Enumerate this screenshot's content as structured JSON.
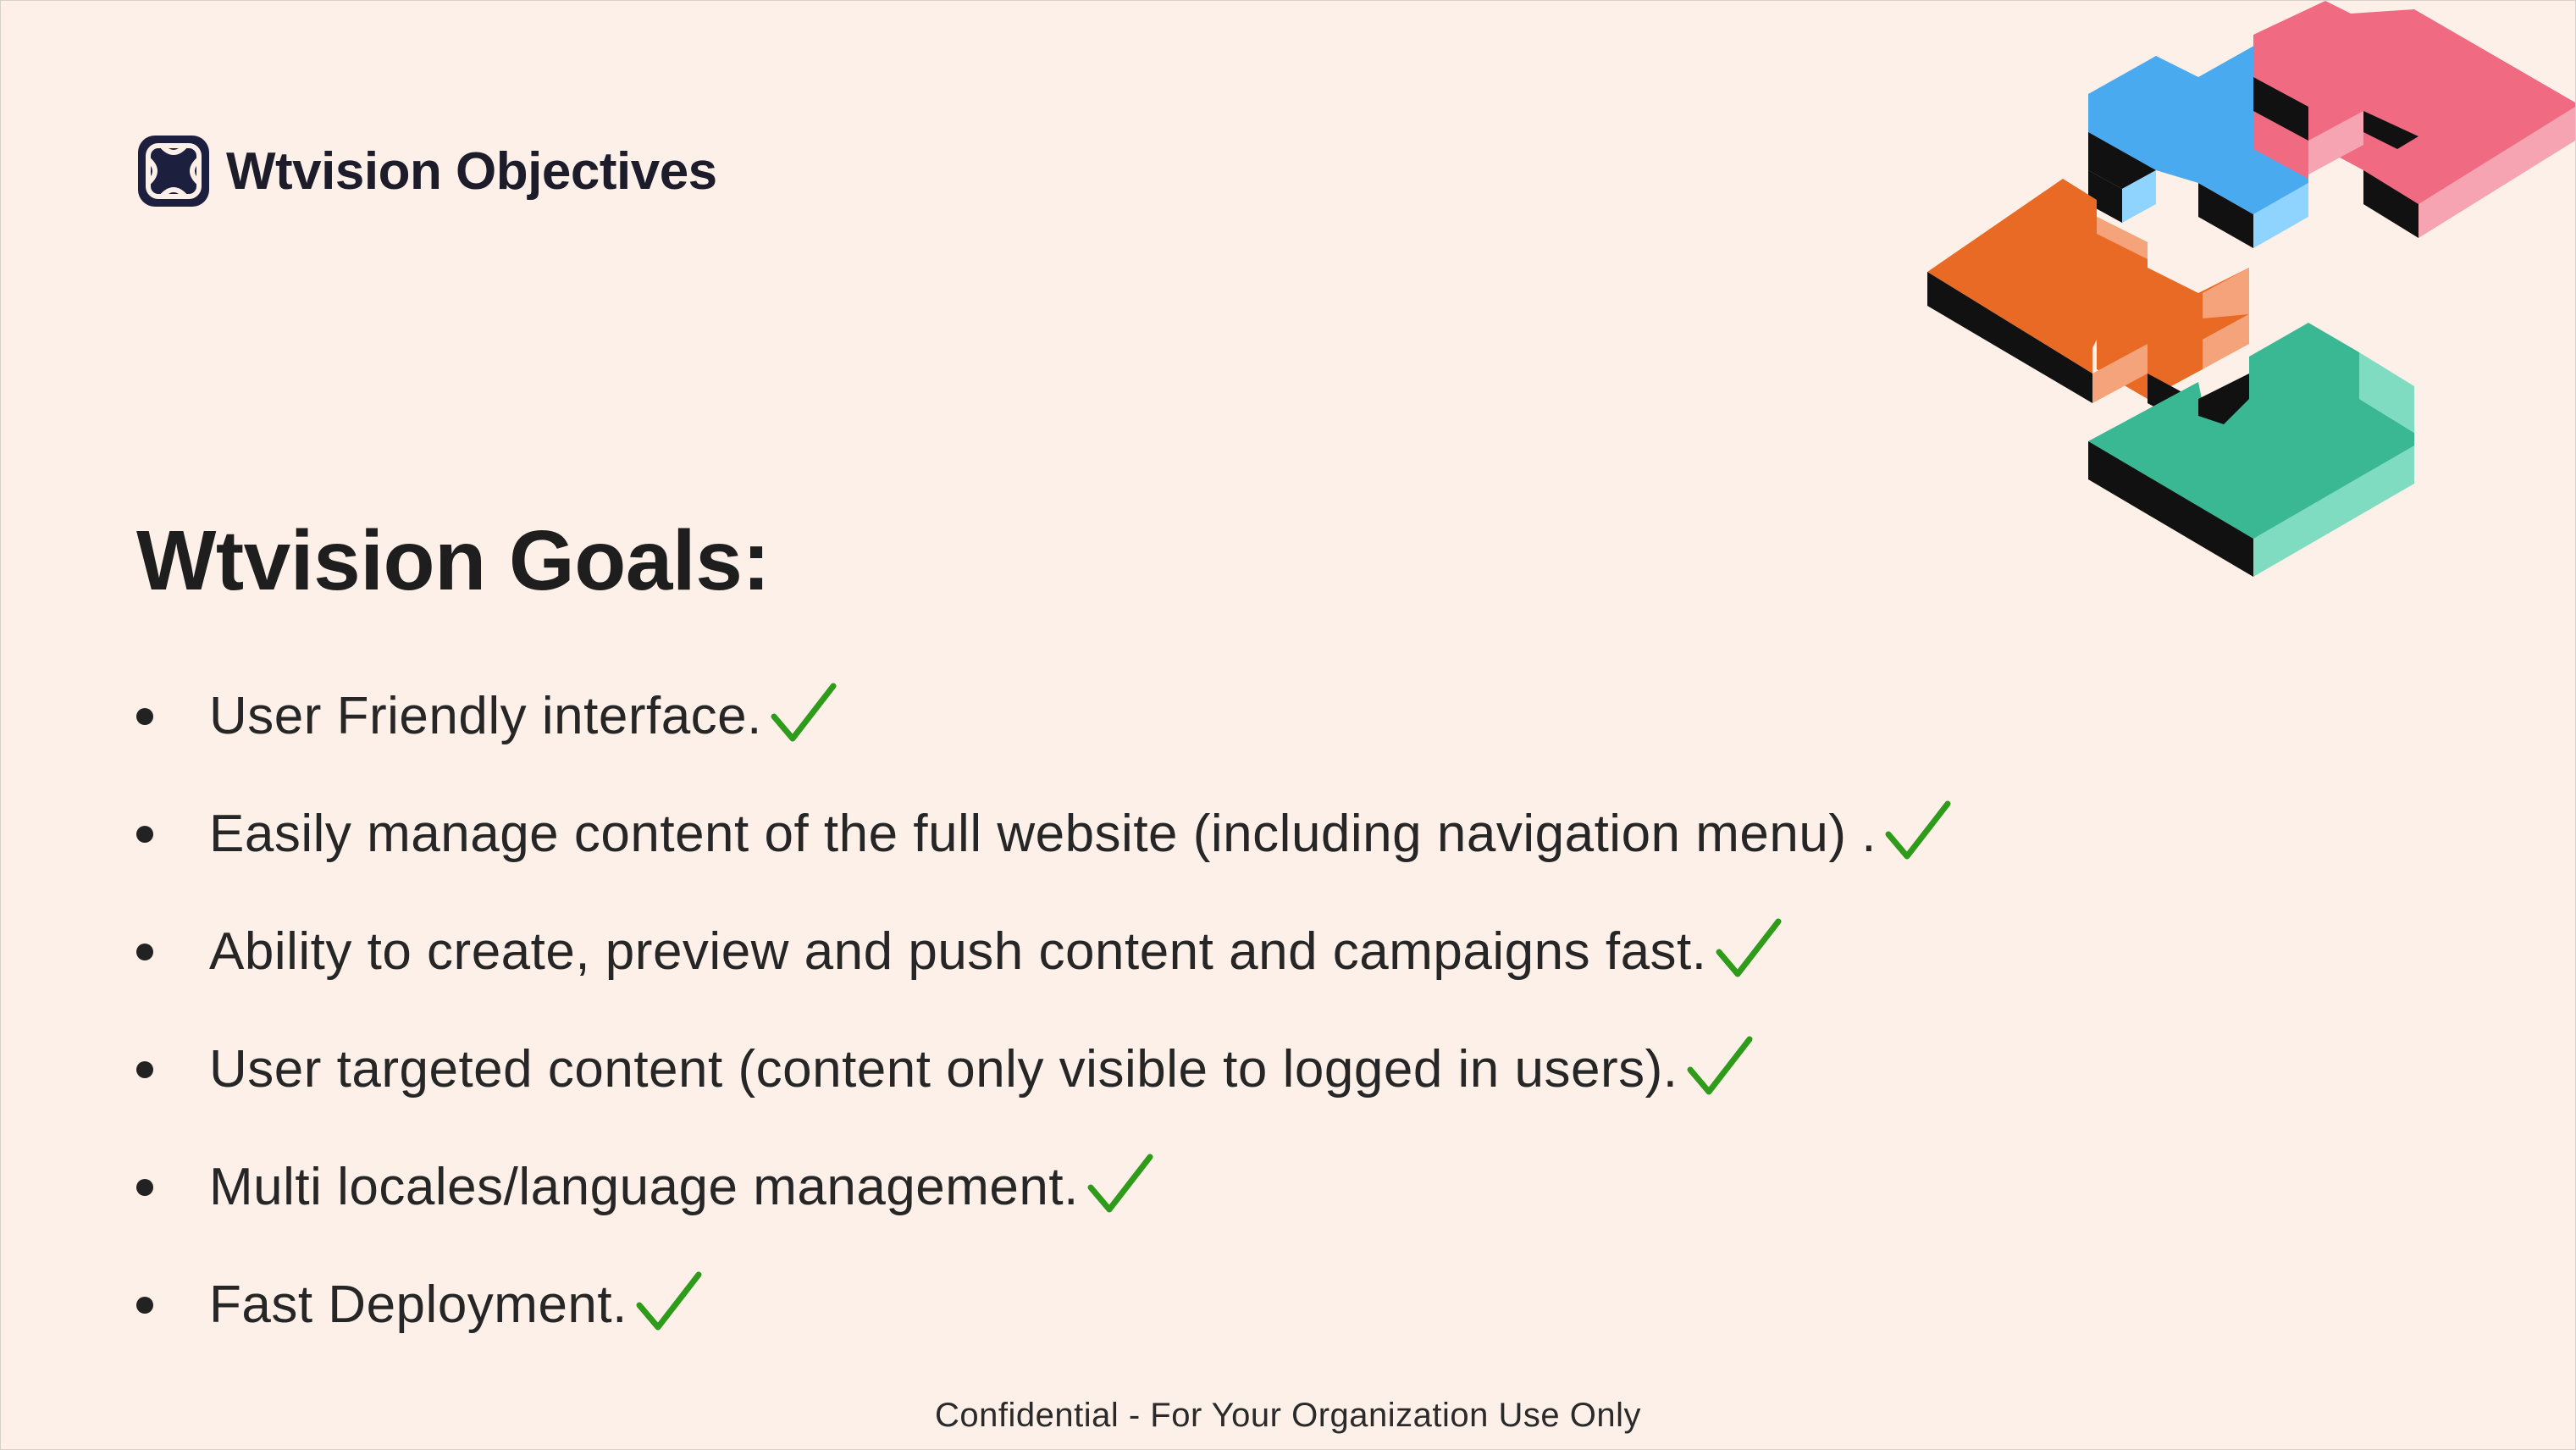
{
  "brand": {
    "name": "Wtvision Objectives",
    "logo_icon": "logo-icon"
  },
  "heading": "Wtvision Goals:",
  "goals": [
    {
      "text": "User Friendly interface.",
      "done": true
    },
    {
      "text": "Easily manage content of the full website (including navigation menu) .",
      "done": true
    },
    {
      "text": "Ability to create, preview and push content and campaigns fast.",
      "done": true
    },
    {
      "text": "User targeted content (content only visible to logged in users).",
      "done": true
    },
    {
      "text": "Multi locales/language management.",
      "done": true
    },
    {
      "text": "Fast Deployment.",
      "done": true
    }
  ],
  "footer": "Confidential - For Your Organization Use Only",
  "colors": {
    "background": "#fdf0e8",
    "check": "#2e9b1a",
    "puzzle_blue": "#4aaaf0",
    "puzzle_pink": "#f06a82",
    "puzzle_orange": "#e86a24",
    "puzzle_green": "#3ab894"
  }
}
